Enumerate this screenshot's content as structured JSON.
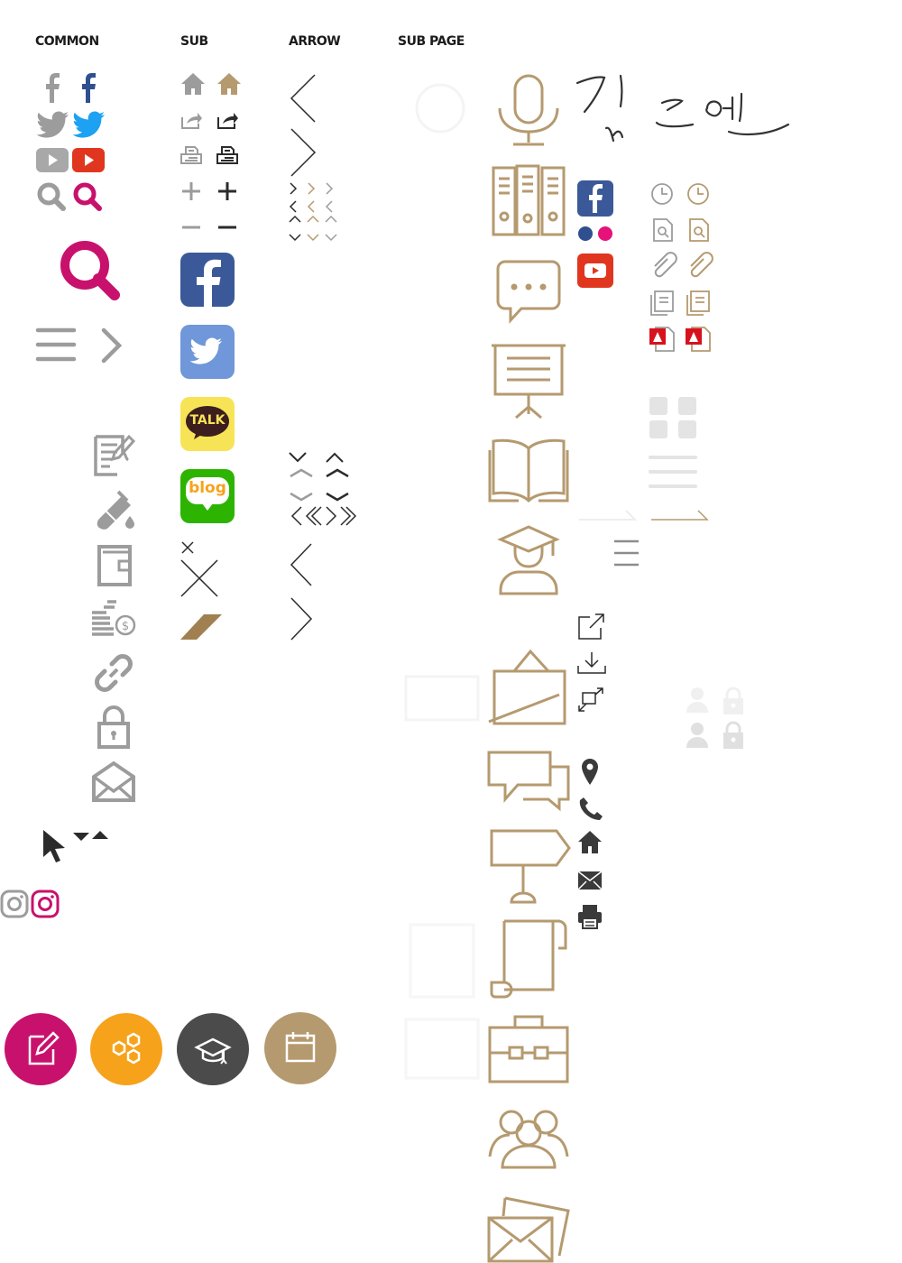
{
  "headers": {
    "common": "COMMON",
    "sub": "SUB",
    "arrow": "ARROW",
    "subpage": "SUB PAGE"
  },
  "badges": {
    "kakao": "TALK",
    "blog": "blog"
  },
  "signature": "김도연",
  "colors": {
    "gray": "#9c9c9c",
    "dark": "#2b2b2b",
    "gold": "#b59a6f",
    "magenta": "#c8116c",
    "facebook": "#3b5998",
    "twitter": "#1da1f2",
    "youtube": "#e0361f",
    "orange": "#f7a21b",
    "charcoal": "#4b4b4b",
    "kakao": "#f7e356",
    "naver": "#2db400",
    "pdf": "#d7121c"
  },
  "icons": {
    "common": [
      "facebook-icon",
      "twitter-icon",
      "youtube-icon",
      "search-icon",
      "search-large-icon",
      "menu-icon",
      "chevron-right-icon"
    ],
    "tools": [
      "edit-note-icon",
      "test-tube-icon",
      "book-icon",
      "money-icon",
      "link-icon",
      "lock-icon",
      "mail-icon",
      "cursor-icon",
      "caret-icon",
      "instagram-icon"
    ],
    "circles": [
      "edit-circle-icon",
      "hexagon-circle-icon",
      "graduation-circle-icon",
      "calendar-circle-icon"
    ],
    "subpage": [
      "microphone-icon",
      "binder-icon",
      "chat-bubble-icon",
      "presentation-icon",
      "open-book-icon",
      "graduate-icon",
      "easel-icon",
      "conversation-icon",
      "signpost-icon",
      "scroll-icon",
      "briefcase-icon",
      "group-icon",
      "envelopes-icon"
    ]
  }
}
